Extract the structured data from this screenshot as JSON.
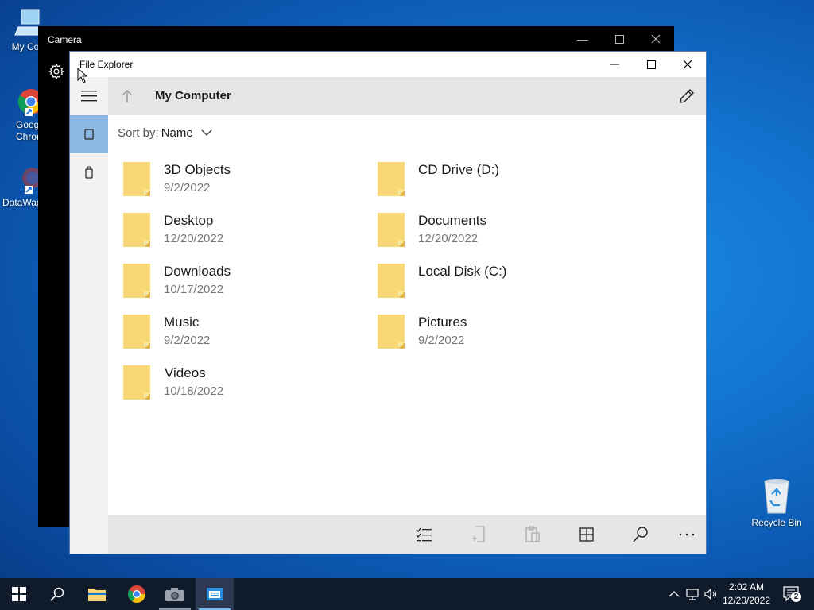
{
  "desktop": {
    "icons": [
      {
        "label": "My Com"
      },
      {
        "label": "Goog Chron"
      },
      {
        "label": "DataWag"
      }
    ],
    "recycle_bin": "Recycle Bin"
  },
  "camera_window": {
    "title": "Camera"
  },
  "file_explorer": {
    "title": "File Explorer",
    "location": "My Computer",
    "sort_label": "Sort by:",
    "sort_value": "Name",
    "items": [
      {
        "name": "3D Objects",
        "date": "9/2/2022"
      },
      {
        "name": "CD Drive (D:)",
        "date": ""
      },
      {
        "name": "Desktop",
        "date": "12/20/2022"
      },
      {
        "name": "Documents",
        "date": "12/20/2022"
      },
      {
        "name": "Downloads",
        "date": "10/17/2022"
      },
      {
        "name": "Local Disk (C:)",
        "date": ""
      },
      {
        "name": "Music",
        "date": "9/2/2022"
      },
      {
        "name": "Pictures",
        "date": "9/2/2022"
      },
      {
        "name": "Videos",
        "date": "10/18/2022"
      }
    ]
  },
  "taskbar": {
    "time": "2:02 AM",
    "date": "12/20/2022",
    "notification_count": "2"
  },
  "colors": {
    "nav_selected": "#8cb6e3",
    "folder": "#f8d775",
    "taskbar": "#0f1a2b"
  }
}
